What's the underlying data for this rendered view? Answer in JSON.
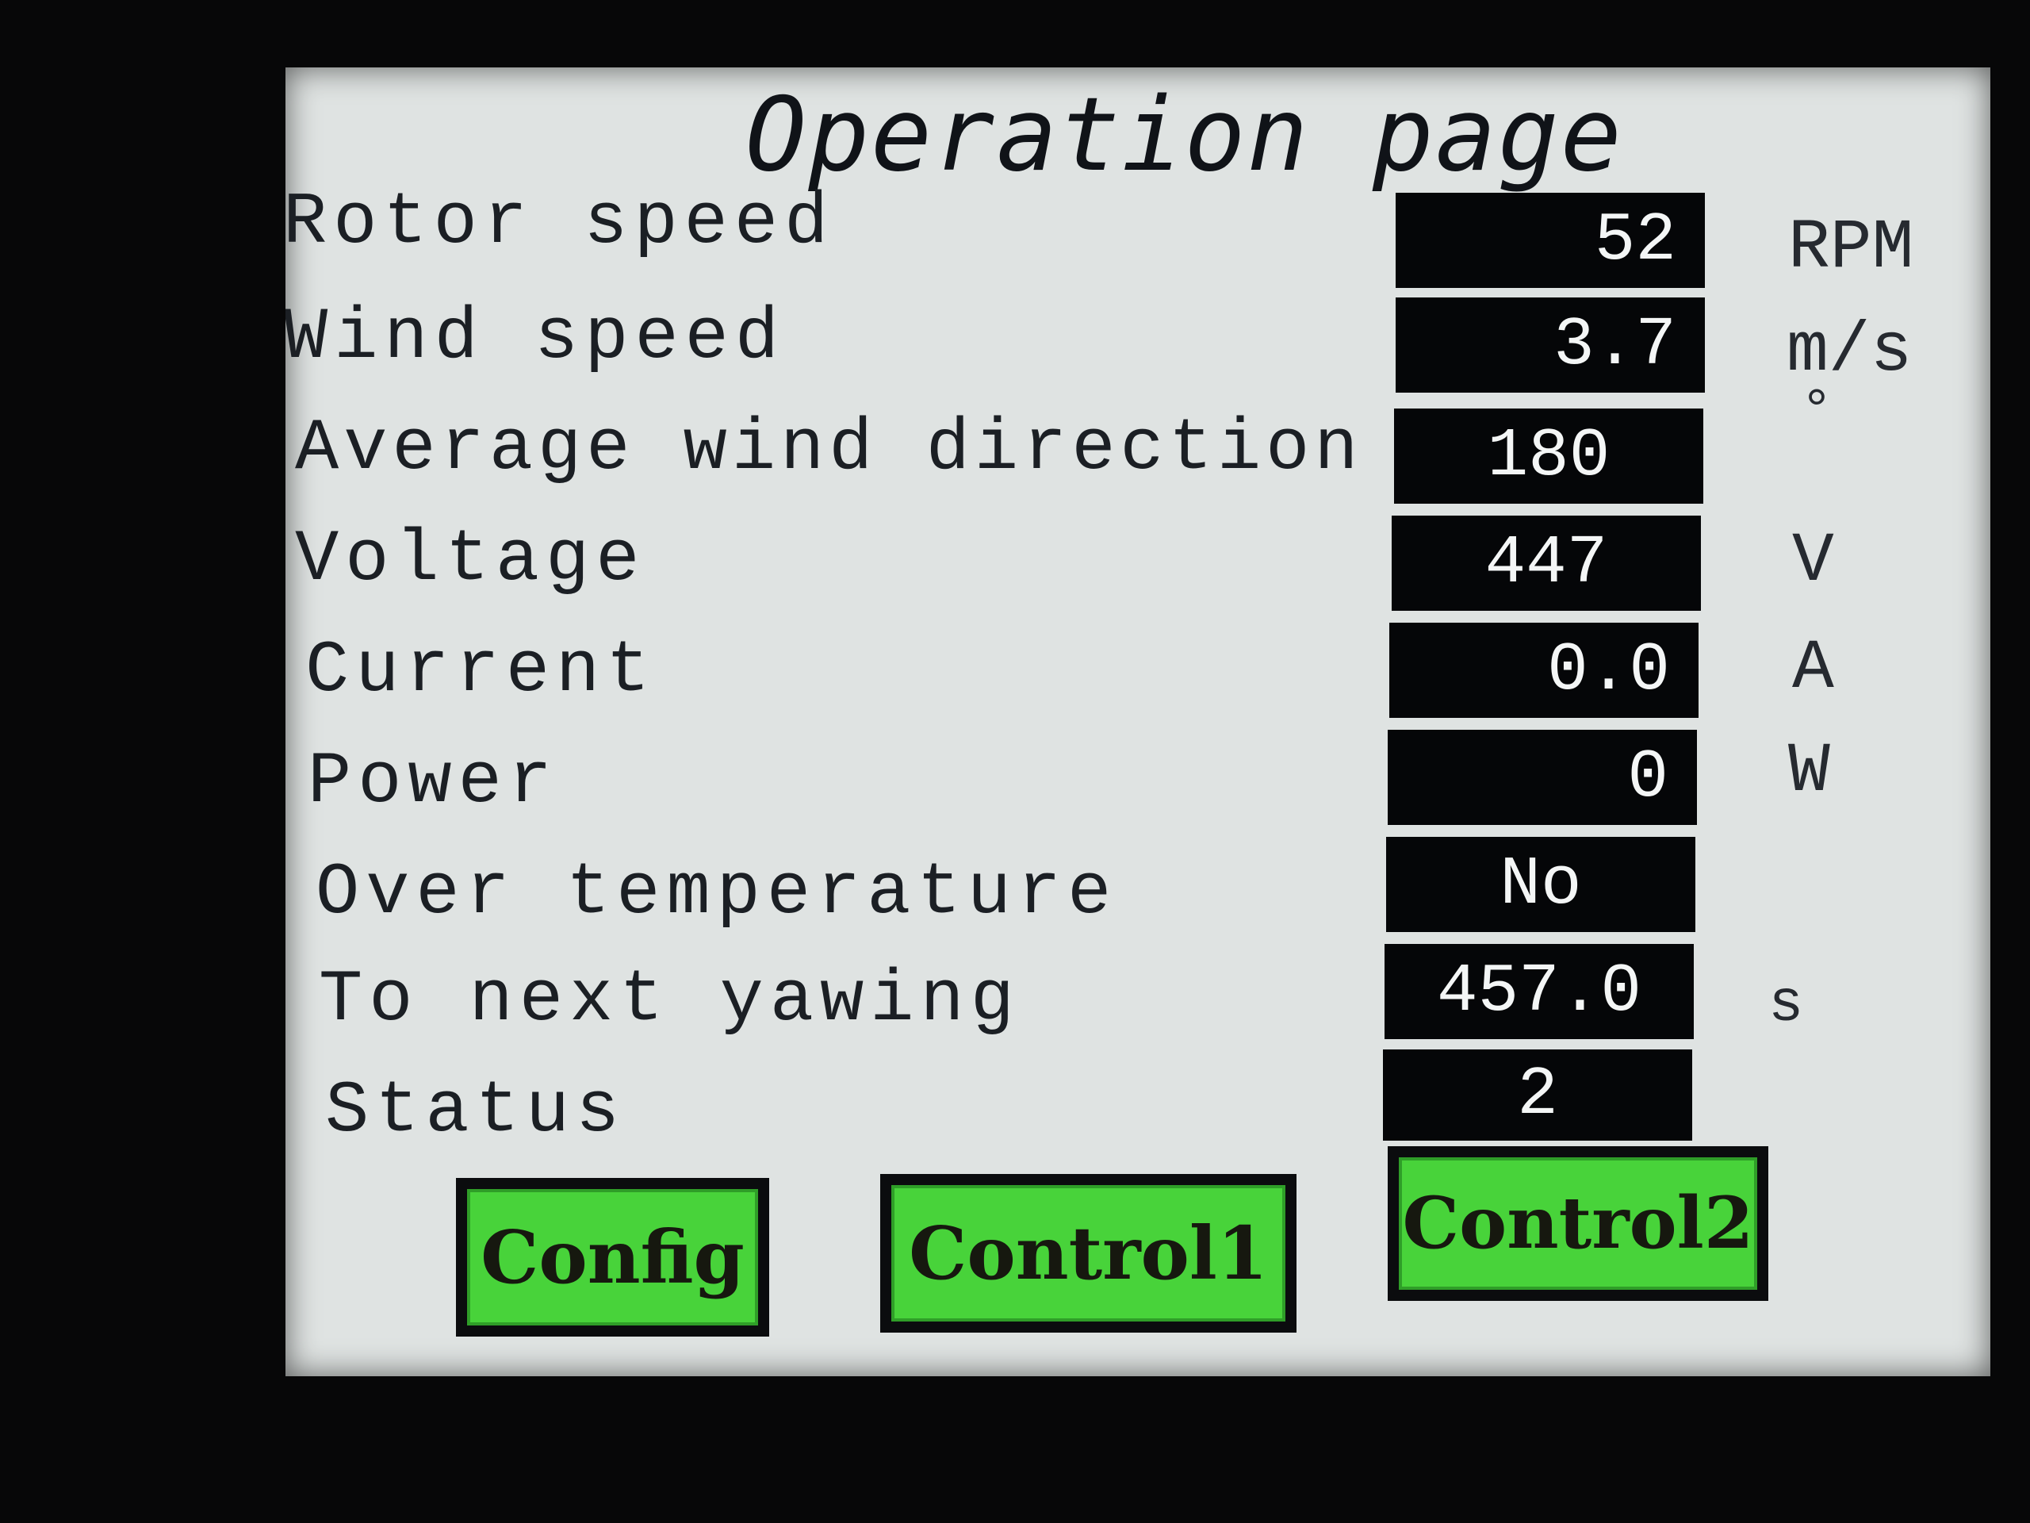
{
  "page": {
    "title": "Operation page"
  },
  "rows": [
    {
      "label": "Rotor speed",
      "value": "52",
      "unit": "RPM"
    },
    {
      "label": "Wind speed",
      "value": "3.7",
      "unit": "m/s"
    },
    {
      "label": "Average wind direction",
      "value": "180",
      "unit": "°"
    },
    {
      "label": "Voltage",
      "value": "447",
      "unit": "V"
    },
    {
      "label": "Current",
      "value": "0.0",
      "unit": "A"
    },
    {
      "label": "Power",
      "value": "0",
      "unit": "W"
    },
    {
      "label": "Over temperature",
      "value": "No",
      "unit": ""
    },
    {
      "label": "To next yawing",
      "value": "457.0",
      "unit": "s"
    },
    {
      "label": "Status",
      "value": "2",
      "unit": ""
    }
  ],
  "buttons": {
    "config": "Config",
    "control1": "Control1",
    "control2": "Control2"
  },
  "colors": {
    "screen_bg": "#dfe3e2",
    "value_box_bg": "#050608",
    "button_green": "#48d33a"
  }
}
